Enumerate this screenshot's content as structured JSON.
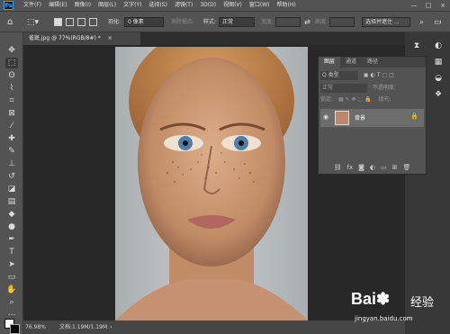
{
  "app": {
    "logo": "Ps"
  },
  "menu": [
    "文件(F)",
    "编辑(E)",
    "图像(I)",
    "图层(L)",
    "文字(Y)",
    "选择(S)",
    "滤镜(T)",
    "3D(D)",
    "视图(V)",
    "窗口(W)",
    "帮助(H)"
  ],
  "window_controls": [
    "—",
    "□",
    "×"
  ],
  "options": {
    "feather_label": "羽化:",
    "feather_value": "0 像素",
    "antialias_label": "消除锯齿",
    "style_label": "样式:",
    "style_value": "正常",
    "width_label": "宽度:",
    "height_label": "高度:",
    "select_mask_label": "选择并遮住 ..."
  },
  "document": {
    "tab_title": "雀斑.jpg @ 77%(RGB/8#) *",
    "close": "×"
  },
  "status": {
    "zoom": "76.98%",
    "doc_info": "文档:1.19M/1.19M",
    "arrow": "›"
  },
  "layers_panel": {
    "tabs": [
      "图层",
      "通道",
      "路径"
    ],
    "kind_filter": "Q 类型",
    "blend_mode": "正常",
    "opacity_label": "不透明度:",
    "lock_label": "锁定:",
    "fill_label": "填充:",
    "layer_name": "背景",
    "footer_icons": [
      "link-icon",
      "fx-icon",
      "mask-icon",
      "adjustment-icon",
      "group-icon",
      "new-layer-icon",
      "trash-icon"
    ]
  },
  "tools": [
    "move",
    "marquee",
    "lasso",
    "quick-select",
    "crop",
    "frame",
    "eyedropper",
    "healing",
    "brush",
    "stamp",
    "history-brush",
    "eraser",
    "gradient",
    "blur",
    "dodge",
    "pen",
    "type",
    "path-select",
    "rectangle",
    "hand",
    "zoom",
    "more"
  ],
  "watermark": {
    "brand": "Bai",
    "brand2": "百",
    "brand3": "经验",
    "url": "jingyan.baidu.com"
  }
}
